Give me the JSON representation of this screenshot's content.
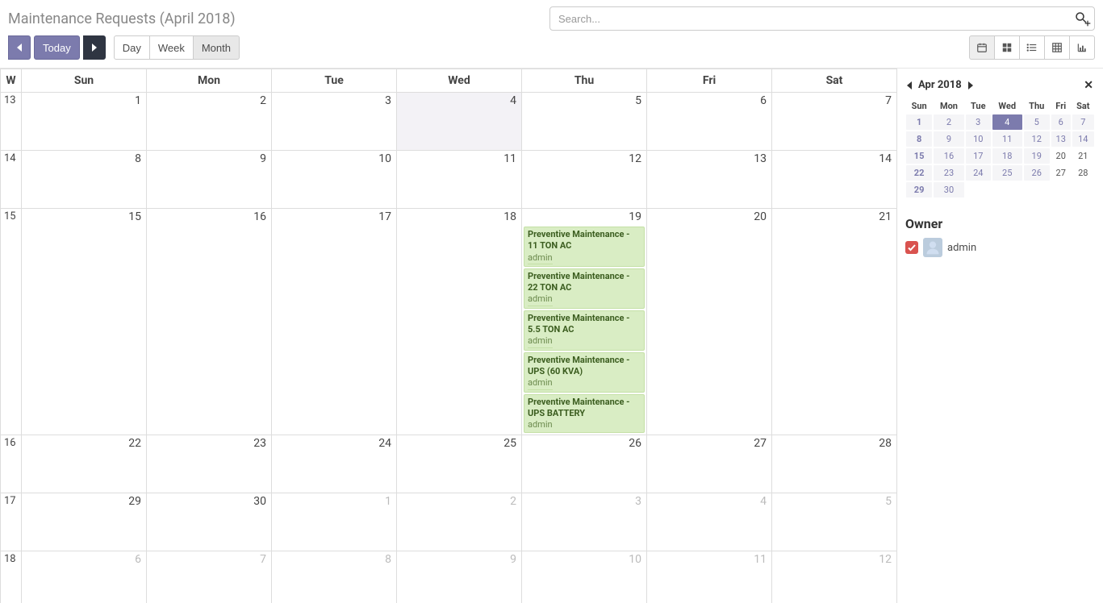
{
  "header": {
    "title": "Maintenance Requests (April 2018)",
    "search_placeholder": "Search..."
  },
  "toolbar": {
    "today_label": "Today",
    "day_label": "Day",
    "week_label": "Week",
    "month_label": "Month"
  },
  "calendar": {
    "weekday_headers": [
      "W",
      "Sun",
      "Mon",
      "Tue",
      "Wed",
      "Thu",
      "Fri",
      "Sat"
    ],
    "rows": [
      {
        "week": "13",
        "days": [
          {
            "n": "1"
          },
          {
            "n": "2"
          },
          {
            "n": "3"
          },
          {
            "n": "4",
            "today": true
          },
          {
            "n": "5"
          },
          {
            "n": "6"
          },
          {
            "n": "7"
          }
        ]
      },
      {
        "week": "14",
        "days": [
          {
            "n": "8"
          },
          {
            "n": "9"
          },
          {
            "n": "10"
          },
          {
            "n": "11"
          },
          {
            "n": "12"
          },
          {
            "n": "13"
          },
          {
            "n": "14"
          }
        ]
      },
      {
        "week": "15",
        "days": [
          {
            "n": "15"
          },
          {
            "n": "16"
          },
          {
            "n": "17"
          },
          {
            "n": "18"
          },
          {
            "n": "19",
            "events": [
              {
                "title": "Preventive Maintenance - 11 TON AC",
                "owner": "admin"
              },
              {
                "title": "Preventive Maintenance - 22 TON AC",
                "owner": "admin"
              },
              {
                "title": "Preventive Maintenance - 5.5 TON AC",
                "owner": "admin"
              },
              {
                "title": "Preventive Maintenance - UPS (60 KVA)",
                "owner": "admin"
              },
              {
                "title": "Preventive Maintenance - UPS BATTERY",
                "owner": "admin"
              }
            ]
          },
          {
            "n": "20"
          },
          {
            "n": "21"
          }
        ]
      },
      {
        "week": "16",
        "days": [
          {
            "n": "22"
          },
          {
            "n": "23"
          },
          {
            "n": "24"
          },
          {
            "n": "25"
          },
          {
            "n": "26"
          },
          {
            "n": "27"
          },
          {
            "n": "28"
          }
        ]
      },
      {
        "week": "17",
        "days": [
          {
            "n": "29"
          },
          {
            "n": "30"
          },
          {
            "n": "1",
            "muted": true
          },
          {
            "n": "2",
            "muted": true
          },
          {
            "n": "3",
            "muted": true
          },
          {
            "n": "4",
            "muted": true
          },
          {
            "n": "5",
            "muted": true
          }
        ]
      },
      {
        "week": "18",
        "days": [
          {
            "n": "6",
            "muted": true
          },
          {
            "n": "7",
            "muted": true
          },
          {
            "n": "8",
            "muted": true
          },
          {
            "n": "9",
            "muted": true
          },
          {
            "n": "10",
            "muted": true
          },
          {
            "n": "11",
            "muted": true
          },
          {
            "n": "12",
            "muted": true
          }
        ]
      }
    ]
  },
  "minical": {
    "title": "Apr 2018",
    "day_headers": [
      "Sun",
      "Mon",
      "Tue",
      "Wed",
      "Thu",
      "Fri",
      "Sat"
    ],
    "rows": [
      [
        {
          "n": "1"
        },
        {
          "n": "2"
        },
        {
          "n": "3"
        },
        {
          "n": "4",
          "selected": true
        },
        {
          "n": "5"
        },
        {
          "n": "6"
        },
        {
          "n": "7"
        }
      ],
      [
        {
          "n": "8"
        },
        {
          "n": "9"
        },
        {
          "n": "10"
        },
        {
          "n": "11"
        },
        {
          "n": "12"
        },
        {
          "n": "13"
        },
        {
          "n": "14"
        }
      ],
      [
        {
          "n": "15"
        },
        {
          "n": "16"
        },
        {
          "n": "17"
        },
        {
          "n": "18"
        },
        {
          "n": "19"
        },
        {
          "n": "20",
          "plain": true
        },
        {
          "n": "21",
          "plain": true
        }
      ],
      [
        {
          "n": "22"
        },
        {
          "n": "23"
        },
        {
          "n": "24"
        },
        {
          "n": "25"
        },
        {
          "n": "26"
        },
        {
          "n": "27",
          "plain": true
        },
        {
          "n": "28",
          "plain": true
        }
      ],
      [
        {
          "n": "29"
        },
        {
          "n": "30"
        },
        null,
        null,
        null,
        null,
        null
      ]
    ]
  },
  "owner_panel": {
    "title": "Owner",
    "items": [
      {
        "name": "admin",
        "checked": true,
        "color": "#d9534f"
      }
    ]
  }
}
